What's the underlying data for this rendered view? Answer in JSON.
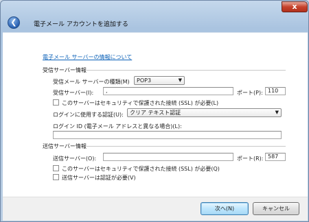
{
  "window": {
    "title": "電子メール アカウントを追加する",
    "close_label": "x"
  },
  "help_link": "電子メール サーバーの情報について",
  "incoming": {
    "heading": "受信サーバー情報",
    "server_type_label": "受信メール サーバーの種類(M)",
    "server_type_value": "POP3",
    "server_label": "受信サーバー(I):",
    "server_value": ",",
    "port_label": "ポート(P):",
    "port_value": "110",
    "ssl_label": "このサーバーはセキュリティで保護された接続 (SSL) が必要(L)",
    "auth_label": "ログインに使用する認証(U):",
    "auth_value": "クリア テキスト認証",
    "login_id_label": "ログイン ID (電子メール アドレスと異なる場合)(L):",
    "login_id_value": ""
  },
  "outgoing": {
    "heading": "送信サーバー情報",
    "server_label": "送信サーバー(O):",
    "server_value": "",
    "port_label": "ポート(R):",
    "port_value": "587",
    "ssl_label": "このサーバーはセキュリティで保護された接続 (SSL) が必要(Q)",
    "auth_required_label": "送信サーバーは認証が必要(V)"
  },
  "buttons": {
    "next": "次へ(N)",
    "cancel": "キャンセル"
  }
}
